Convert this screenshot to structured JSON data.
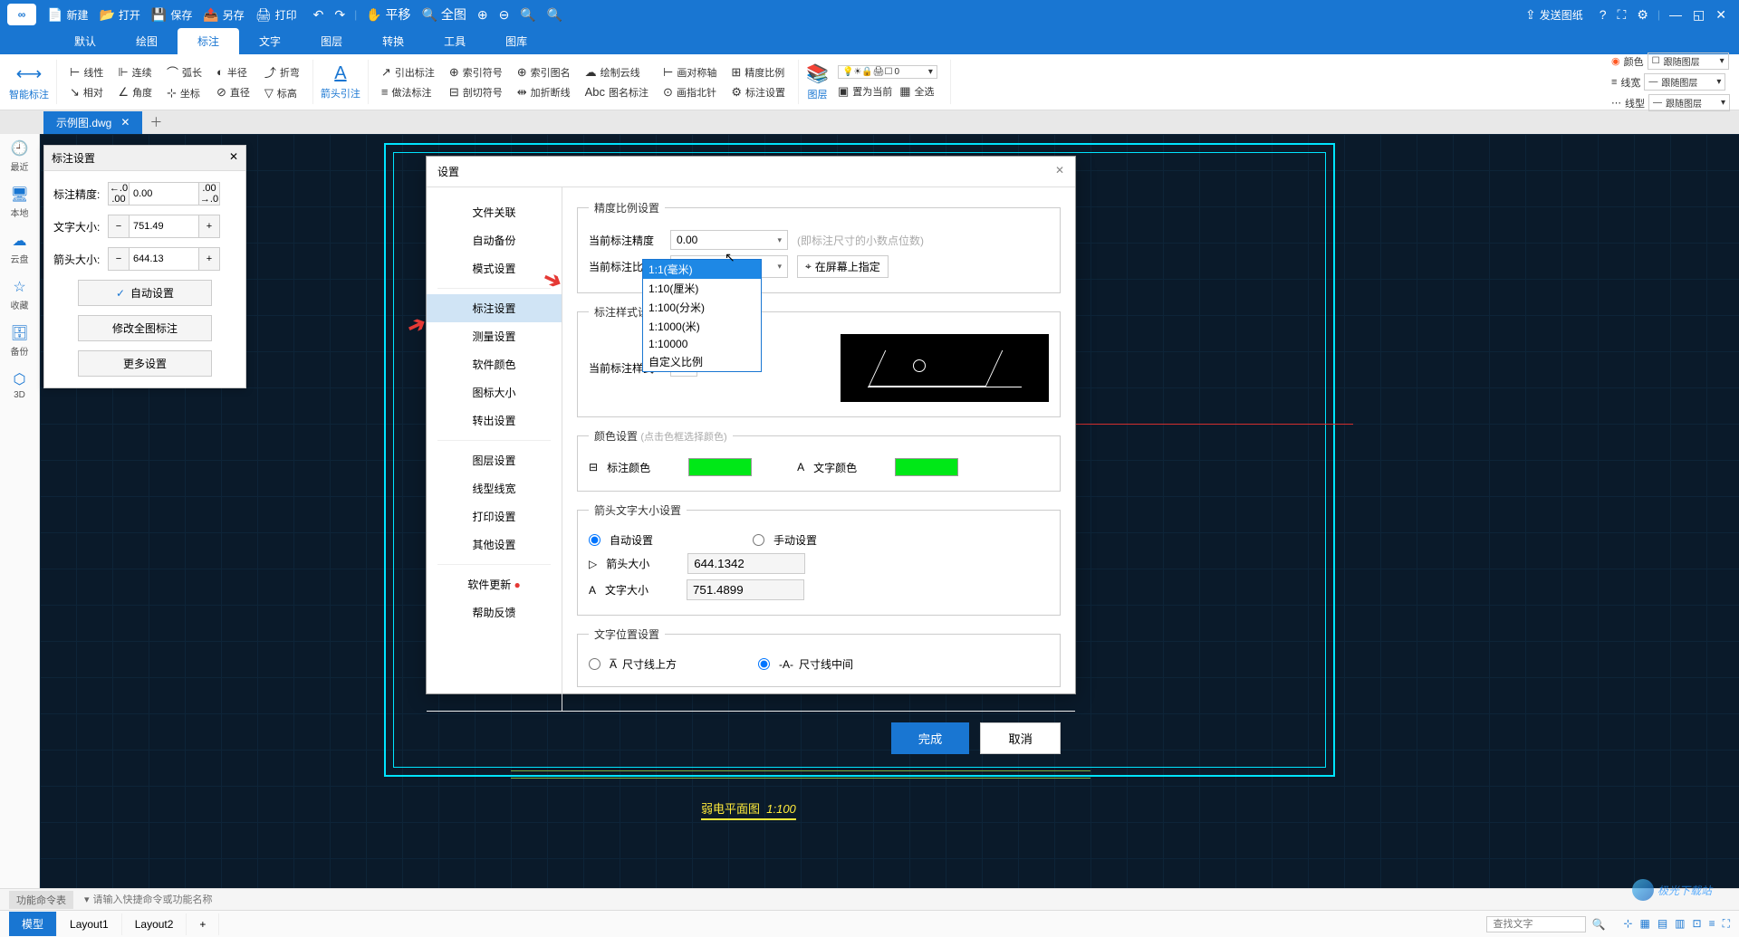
{
  "titlebar": {
    "new": "新建",
    "open": "打开",
    "save": "保存",
    "saveas": "另存",
    "print": "打印",
    "send": "发送图纸"
  },
  "main_tabs": [
    "默认",
    "绘图",
    "标注",
    "文字",
    "图层",
    "转换",
    "工具",
    "图库"
  ],
  "main_tab_active_index": 2,
  "ribbon": {
    "smart": "智能标注",
    "linear": "线性",
    "continuous": "连续",
    "arc": "弧长",
    "radius": "半径",
    "bend": "折弯",
    "relative": "相对",
    "angle": "角度",
    "coord": "坐标",
    "diameter": "直径",
    "annotate": "标高",
    "arrow": "箭头引注",
    "lead": "引出标注",
    "index_sym": "索引符号",
    "index_name": "索引图名",
    "cloud": "绘制云线",
    "sym_axis": "画对称轴",
    "precision": "精度比例",
    "do_anno": "做法标注",
    "section": "剖切符号",
    "break": "加折断线",
    "drawing_name": "图名标注",
    "compass": "画指北针",
    "anno_set": "标注设置",
    "layer": "图层",
    "set_current": "置为当前",
    "select_all": "全选",
    "layer_value": "0",
    "color": "颜色",
    "line_width": "线宽",
    "line_type": "线型",
    "follow_layer": "跟随图层"
  },
  "doc_tab": "示例图.dwg",
  "left_sidebar": [
    "最近",
    "本地",
    "云盘",
    "收藏",
    "备份",
    "3D"
  ],
  "anno_panel": {
    "title": "标注设置",
    "precision_label": "标注精度:",
    "precision_value": "0.00",
    "textsize_label": "文字大小:",
    "textsize_value": "751.49",
    "arrowsize_label": "箭头大小:",
    "arrowsize_value": "644.13",
    "auto_set": "自动设置",
    "edit_all": "修改全图标注",
    "more": "更多设置"
  },
  "dialog": {
    "title": "设置",
    "side_items": [
      "文件关联",
      "自动备份",
      "模式设置",
      "标注设置",
      "测量设置",
      "软件颜色",
      "图标大小",
      "转出设置",
      "图层设置",
      "线型线宽",
      "打印设置",
      "其他设置",
      "软件更新",
      "帮助反馈"
    ],
    "side_selected_index": 3,
    "groups": {
      "precision": {
        "legend": "精度比例设置",
        "cur_precision_label": "当前标注精度",
        "cur_precision_value": "0.00",
        "precision_hint": "(即标注尺寸的小数点位数)",
        "cur_scale_label": "当前标注比例",
        "cur_scale_value": "1:1(毫米)",
        "specify_on_screen": "在屏幕上指定"
      },
      "style": {
        "legend": "标注样式设置",
        "cur_style_label": "当前标注样式"
      },
      "color": {
        "legend": "颜色设置",
        "hint": "(点击色框选择颜色)",
        "anno_color_label": "标注颜色",
        "text_color_label": "文字颜色"
      },
      "arrow_text": {
        "legend": "箭头文字大小设置",
        "auto": "自动设置",
        "manual": "手动设置",
        "arrow_label": "箭头大小",
        "arrow_value": "644.1342",
        "text_label": "文字大小",
        "text_value": "751.4899"
      },
      "text_pos": {
        "legend": "文字位置设置",
        "above": "尺寸线上方",
        "middle": "尺寸线中间"
      }
    },
    "dropdown": [
      "1:1(毫米)",
      "1:10(厘米)",
      "1:100(分米)",
      "1:1000(米)",
      "1:10000",
      "自定义比例"
    ],
    "dropdown_selected_index": 0,
    "ok": "完成",
    "cancel": "取消"
  },
  "drawing": {
    "title_text": "弱电平面图",
    "scale_text": "1:100"
  },
  "cmd": {
    "label": "功能命令表",
    "placeholder": "请输入快捷命令或功能名称"
  },
  "bottom": {
    "tabs": [
      "模型",
      "Layout1",
      "Layout2"
    ],
    "active_index": 0,
    "search_placeholder": "查找文字"
  },
  "watermark": "极光下载站"
}
